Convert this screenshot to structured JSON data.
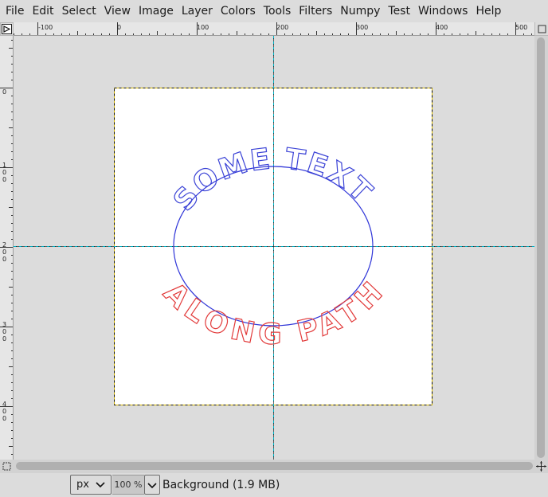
{
  "menubar": {
    "items": [
      "File",
      "Edit",
      "Select",
      "View",
      "Image",
      "Layer",
      "Colors",
      "Tools",
      "Filters",
      "Numpy",
      "Test",
      "Windows",
      "Help"
    ]
  },
  "ruler_top": {
    "labels": [
      "-100",
      "0",
      "100",
      "200",
      "300",
      "400",
      "500"
    ]
  },
  "ruler_left": {
    "labels": [
      "0",
      "100",
      "200",
      "300",
      "400"
    ]
  },
  "canvas": {
    "text_top": "SOME TEXT",
    "text_bottom": "ALONG PATH",
    "colors": {
      "text_top": "#3b43d6",
      "text_bottom": "#e23a3a",
      "path": "#2f35d8",
      "guide": "#00b5c8",
      "selection": "#e0c000"
    }
  },
  "statusbar": {
    "unit": "px",
    "zoom": "100 %",
    "layer_info": "Background (1.9 MB)"
  },
  "icons": {
    "ruler_corner": "quick-mask-triangle-icon",
    "nav": "navigate-crosshair-icon",
    "quick_mask": "quick-mask-toggle-icon"
  }
}
